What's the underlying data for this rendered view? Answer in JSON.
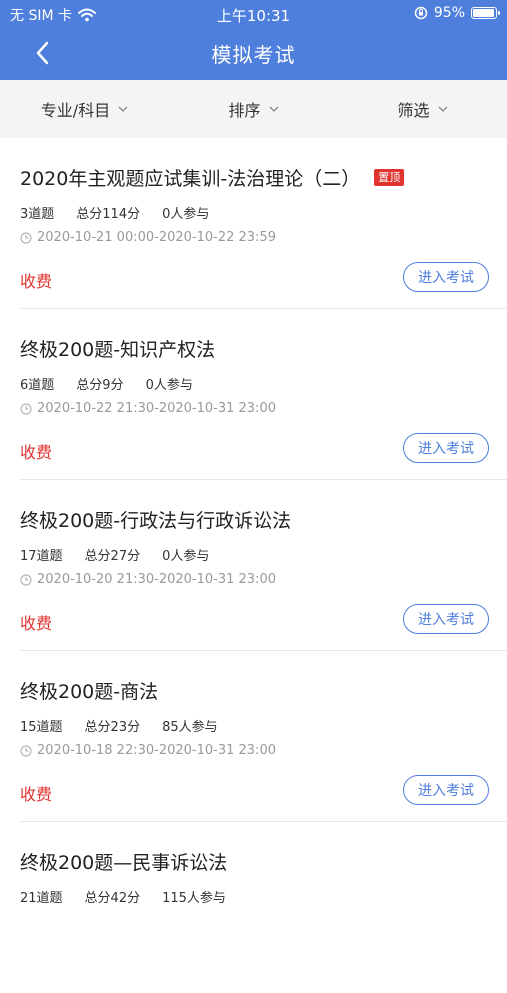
{
  "status_bar": {
    "carrier": "无 SIM 卡",
    "time": "上午10:31",
    "battery_text": "95%",
    "battery_level": 0.95
  },
  "nav": {
    "title": "模拟考试"
  },
  "filters": [
    {
      "label": "专业/科目"
    },
    {
      "label": "排序"
    },
    {
      "label": "筛选"
    }
  ],
  "exams": [
    {
      "title": "2020年主观题应试集训-法治理论（二）",
      "badge": "置顶",
      "questions": "3道题",
      "score": "总分114分",
      "participants": "0人参与",
      "time_range": "2020-10-21 00:00-2020-10-22 23:59",
      "price": "收费",
      "button": "进入考试"
    },
    {
      "title": "终极200题-知识产权法",
      "badge": "",
      "questions": "6道题",
      "score": "总分9分",
      "participants": "0人参与",
      "time_range": "2020-10-22 21:30-2020-10-31 23:00",
      "price": "收费",
      "button": "进入考试"
    },
    {
      "title": "终极200题-行政法与行政诉讼法",
      "badge": "",
      "questions": "17道题",
      "score": "总分27分",
      "participants": "0人参与",
      "time_range": "2020-10-20 21:30-2020-10-31 23:00",
      "price": "收费",
      "button": "进入考试"
    },
    {
      "title": "终极200题-商法",
      "badge": "",
      "questions": "15道题",
      "score": "总分23分",
      "participants": "85人参与",
      "time_range": "2020-10-18 22:30-2020-10-31 23:00",
      "price": "收费",
      "button": "进入考试"
    },
    {
      "title": "终极200题—民事诉讼法",
      "badge": "",
      "questions": "21道题",
      "score": "总分42分",
      "participants": "115人参与",
      "time_range": "",
      "price": "",
      "button": ""
    }
  ],
  "colors": {
    "primary": "#4f7fdc",
    "price_red": "#e0342f",
    "badge_red": "#e0342f",
    "filter_bg": "#f4f4f4"
  }
}
